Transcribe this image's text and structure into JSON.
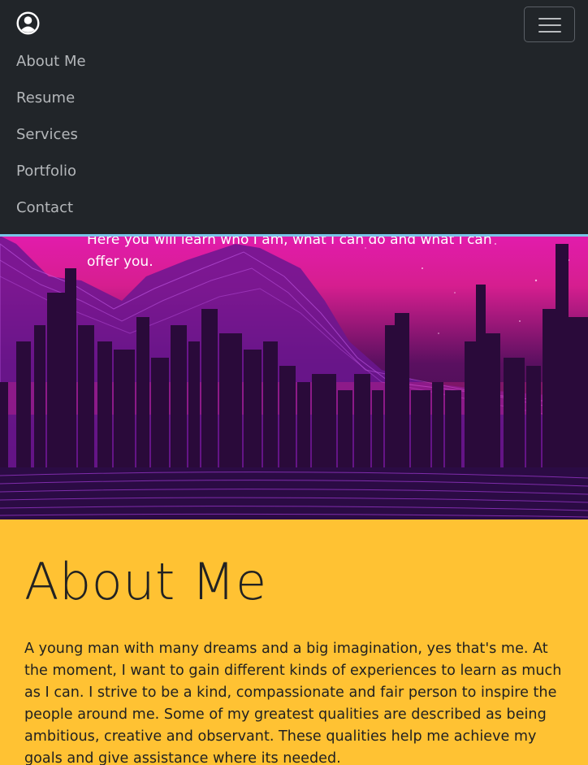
{
  "navbar": {
    "brand_icon": "user-circle-icon",
    "toggler_icon": "hamburger-menu-icon",
    "items": [
      {
        "label": "About Me"
      },
      {
        "label": "Resume"
      },
      {
        "label": "Services"
      },
      {
        "label": "Portfolio"
      },
      {
        "label": "Contact"
      }
    ],
    "background": "#212529",
    "border_color": "#79c6e8"
  },
  "hero": {
    "line1": "Here you will learn who I am, what I can do and what I can",
    "line2": "offer you."
  },
  "about": {
    "title": "About Me",
    "body": "A young man with many dreams and a big imagination, yes that's me. At the moment, I want to gain different kinds of experiences to learn as much as I can. I strive to be a kind, compassionate and fair person to inspire the people around me. Some of my greatest qualities are described as being ambitious, creative and observant. These qualities help me achieve my goals and give assistance where its needed.",
    "background": "#ffc233"
  }
}
